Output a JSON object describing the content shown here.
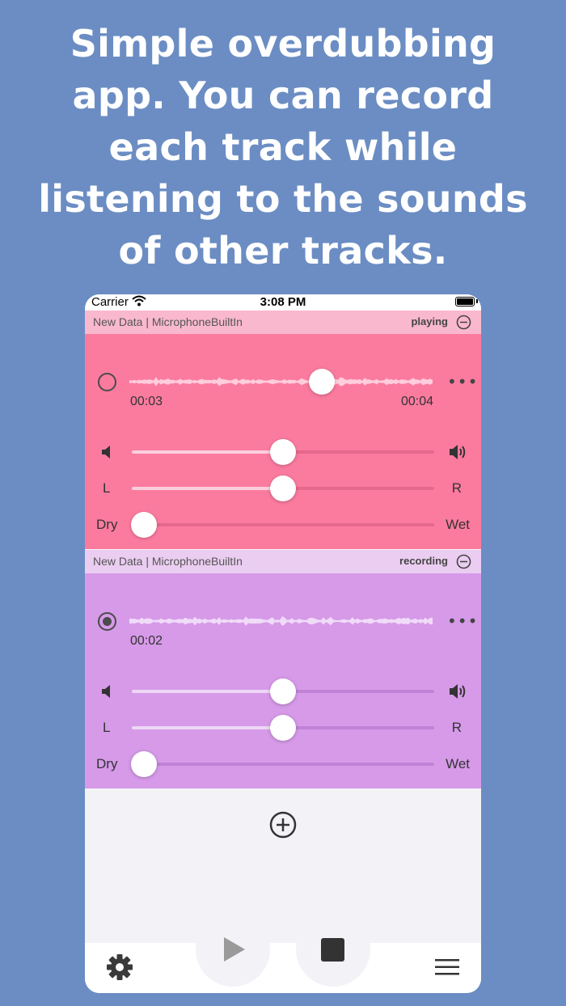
{
  "headline": {
    "lines": [
      "Simple overdubbing",
      "app. You can record",
      "each track while",
      "listening to the sounds",
      "of other tracks."
    ]
  },
  "status_bar": {
    "carrier": "Carrier",
    "time": "3:08 PM"
  },
  "tracks": [
    {
      "name": "New Data | MicrophoneBuiltIn",
      "status": "playing",
      "record_armed": false,
      "time_current": "00:03",
      "time_total": "00:04",
      "playhead_fraction": 0.63,
      "volume_fraction": 0.5,
      "pan_fraction": 0.5,
      "drywet_fraction": 0.04,
      "pan_left_label": "L",
      "pan_right_label": "R",
      "dry_label": "Dry",
      "wet_label": "Wet",
      "header_color": "#f9b8cd",
      "panel_color": "#fb7b9f"
    },
    {
      "name": "New Data | MicrophoneBuiltIn",
      "status": "recording",
      "record_armed": true,
      "time_current": "00:02",
      "volume_fraction": 0.5,
      "pan_fraction": 0.5,
      "drywet_fraction": 0.04,
      "pan_left_label": "L",
      "pan_right_label": "R",
      "dry_label": "Dry",
      "wet_label": "Wet",
      "header_color": "#ebcdf1",
      "panel_color": "#d69ae8"
    }
  ],
  "icons": {
    "add": "plus-circle-icon",
    "settings": "gear-icon",
    "menu": "hamburger-menu-icon",
    "play": "play-icon",
    "stop": "stop-icon"
  },
  "colors": {
    "background": "#6b8dc3",
    "app_background": "#f2f2f7"
  }
}
